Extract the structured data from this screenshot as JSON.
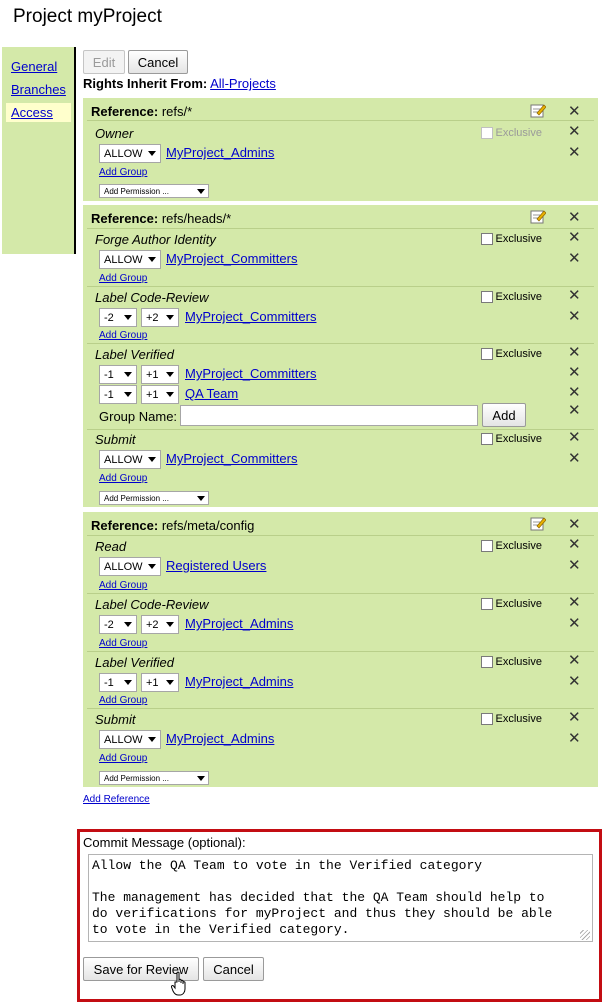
{
  "page": {
    "title": "Project myProject"
  },
  "sidebar": {
    "items": [
      {
        "label": "General"
      },
      {
        "label": "Branches"
      },
      {
        "label": "Access"
      }
    ]
  },
  "toolbar": {
    "edit_label": "Edit",
    "cancel_label": "Cancel"
  },
  "rights": {
    "label": "Rights Inherit From:",
    "link": "All-Projects"
  },
  "common": {
    "ref_label": "Reference:",
    "exclusive": "Exclusive",
    "add_group": "Add Group",
    "add_permission": "Add Permission ...",
    "group_name_label": "Group Name:",
    "add_button": "Add",
    "allow": "ALLOW"
  },
  "references": [
    {
      "name": "refs/*",
      "permissions": [
        {
          "name": "Owner",
          "rules": [
            {
              "action": "ALLOW",
              "group": "MyProject_Admins"
            }
          ]
        }
      ]
    },
    {
      "name": "refs/heads/*",
      "permissions": [
        {
          "name": "Forge Author Identity",
          "rules": [
            {
              "action": "ALLOW",
              "group": "MyProject_Committers"
            }
          ]
        },
        {
          "name": "Label Code-Review",
          "rules": [
            {
              "min": "-2",
              "max": "+2",
              "group": "MyProject_Committers"
            }
          ]
        },
        {
          "name": "Label Verified",
          "rules": [
            {
              "min": "-1",
              "max": "+1",
              "group": "MyProject_Committers"
            },
            {
              "min": "-1",
              "max": "+1",
              "group": "QA Team"
            }
          ]
        },
        {
          "name": "Submit",
          "rules": [
            {
              "action": "ALLOW",
              "group": "MyProject_Committers"
            }
          ]
        }
      ]
    },
    {
      "name": "refs/meta/config",
      "permissions": [
        {
          "name": "Read",
          "rules": [
            {
              "action": "ALLOW",
              "group": "Registered Users"
            }
          ]
        },
        {
          "name": "Label Code-Review",
          "rules": [
            {
              "min": "-2",
              "max": "+2",
              "group": "MyProject_Admins"
            }
          ]
        },
        {
          "name": "Label Verified",
          "rules": [
            {
              "min": "-1",
              "max": "+1",
              "group": "MyProject_Admins"
            }
          ]
        },
        {
          "name": "Submit",
          "rules": [
            {
              "action": "ALLOW",
              "group": "MyProject_Admins"
            }
          ]
        }
      ]
    }
  ],
  "add_reference": "Add Reference",
  "commit": {
    "label": "Commit Message (optional):",
    "message": "Allow the QA Team to vote in the Verified category\n\nThe management has decided that the QA Team should help to\ndo verifications for myProject and thus they should be able\nto vote in the Verified category.",
    "save_label": "Save for Review",
    "cancel_label": "Cancel"
  },
  "colors": {
    "panel": "#d4e9a9",
    "link": "#0000cc",
    "highlight_border": "#c30d13",
    "active_tab": "#ffffcc"
  },
  "icons": {
    "edit": "edit-pencil-icon",
    "remove": "close-x-icon"
  }
}
